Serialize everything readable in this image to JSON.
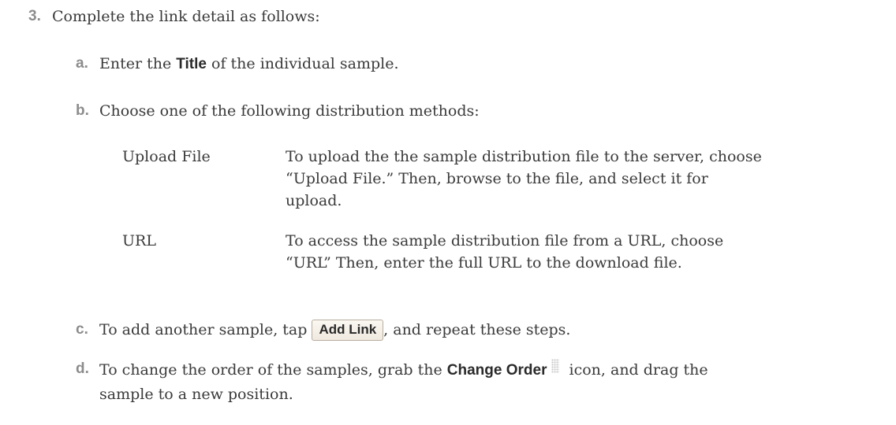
{
  "step": {
    "number": "3.",
    "text": "Complete the link detail as follows:"
  },
  "a": {
    "marker": "a.",
    "pre": "Enter the ",
    "bold": "Title",
    "post": " of the individual sample."
  },
  "b": {
    "marker": "b.",
    "text": "Choose one of the following distribution methods:"
  },
  "methods": [
    {
      "term": "Upload File",
      "desc_lines": [
        "To upload the the sample distribution file to the server, choose",
        "“Upload File.” Then, browse to the file, and select it for",
        "upload."
      ]
    },
    {
      "term": "URL",
      "desc_lines": [
        "To access the sample distribution file from a URL, choose",
        "“URL”  Then, enter the full URL to the download file."
      ]
    }
  ],
  "c": {
    "marker": "c.",
    "pre": "To add another sample, tap ",
    "button": "Add Link",
    "post": ", and repeat these steps."
  },
  "d": {
    "marker": "d.",
    "pre": "To change the order of the samples, grab the ",
    "bold": "Change Order",
    "icon": "grip-icon",
    "post": " icon, and drag the",
    "line2": "sample to a new position."
  }
}
